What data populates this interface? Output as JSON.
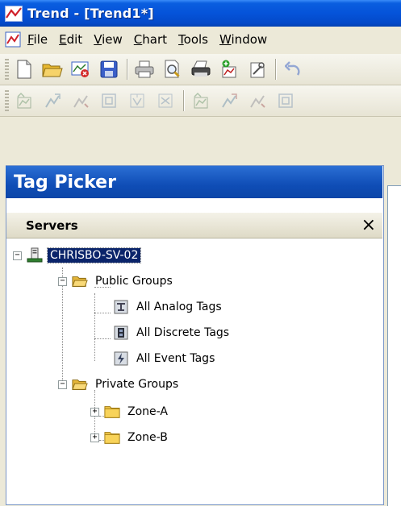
{
  "window": {
    "title": "Trend - [Trend1*]"
  },
  "menu": {
    "items": [
      {
        "label": "File"
      },
      {
        "label": "Edit"
      },
      {
        "label": "View"
      },
      {
        "label": "Chart"
      },
      {
        "label": "Tools"
      },
      {
        "label": "Window"
      }
    ]
  },
  "toolbar1": {
    "icons": [
      "new-file-icon",
      "open-folder-icon",
      "close-file-icon",
      "save-icon",
      "print-icon",
      "print-preview-icon",
      "print-setup-icon",
      "add-tag-icon",
      "configure-icon",
      "undo-icon"
    ]
  },
  "toolbar2": {
    "icons": [
      "chart-tool-1-icon",
      "chart-tool-2-icon",
      "chart-tool-3-icon",
      "chart-tool-4-icon",
      "chart-tool-5-icon",
      "chart-tool-6-icon",
      "chart-tool-7-icon",
      "chart-tool-8-icon",
      "chart-tool-9-icon",
      "chart-tool-10-icon"
    ]
  },
  "tagPicker": {
    "title": "Tag Picker",
    "servers_label": "Servers",
    "close_glyph": "×"
  },
  "tree": {
    "server": "CHRISBO-SV-02",
    "public_groups": "Public Groups",
    "analog": "All Analog Tags",
    "discrete": "All Discrete Tags",
    "event": "All Event Tags",
    "private_groups": "Private Groups",
    "zone_a": "Zone-A",
    "zone_b": "Zone-B",
    "expanded_glyph": "−",
    "collapsed_glyph": "+"
  }
}
